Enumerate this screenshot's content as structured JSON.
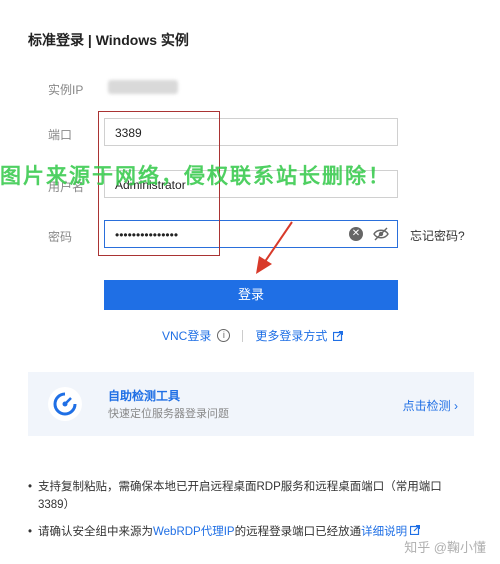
{
  "title": "标准登录 | Windows 实例",
  "form": {
    "ip_label": "实例IP",
    "port_label": "端口",
    "port_value": "3389",
    "user_label": "用户名",
    "user_value": "Administrator",
    "password_label": "密码",
    "password_masked": "•••••••••••••••",
    "forgot_label": "忘记密码?"
  },
  "watermark": "图片来源于网络，侵权联系站长删除！",
  "login_button": "登录",
  "alt_links": {
    "vnc": "VNC登录",
    "more": "更多登录方式"
  },
  "tool_card": {
    "name": "自助检测工具",
    "desc": "快速定位服务器登录问题",
    "link": "点击检测"
  },
  "notes": {
    "n1": "支持复制粘贴，需确保本地已开启远程桌面RDP服务和远程桌面端口（常用端口3389）",
    "n2_a": "请确认安全组中来源为",
    "n2_link": "WebRDP代理IP",
    "n2_b": "的远程登录端口已经放通",
    "n2_detail": "详细说明"
  },
  "footer_mark": "知乎 @鞠小懂",
  "colors": {
    "accent": "#1f6fe5",
    "highlight": "#a33333",
    "watermark": "#30c846"
  }
}
